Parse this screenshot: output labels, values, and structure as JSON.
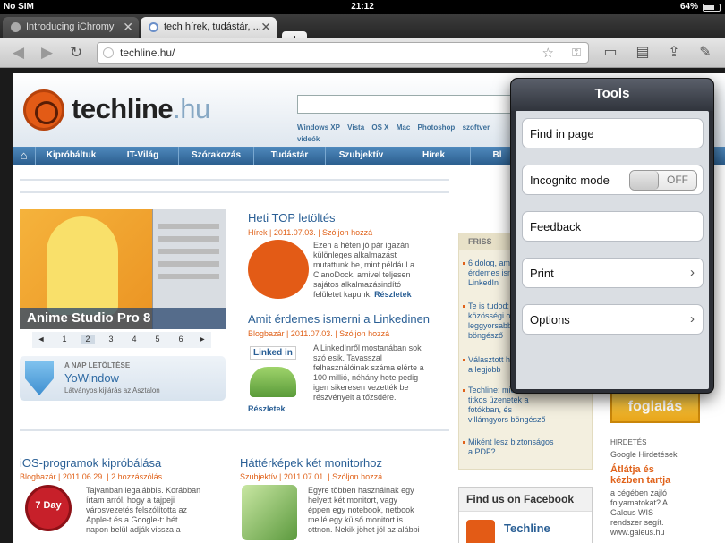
{
  "status": {
    "carrier": "No SIM",
    "time": "21:12",
    "battery": "64%"
  },
  "tabs": [
    {
      "label": "Introducing iChromy"
    },
    {
      "label": "tech hírek, tudástár, ..."
    }
  ],
  "new_tab_label": "+",
  "url": "techline.hu/",
  "site": {
    "logo_main": "techline",
    "logo_tld": ".hu",
    "quicklinks": [
      "Windows XP",
      "Vista",
      "OS X",
      "Mac",
      "Photoshop",
      "szoftver",
      "videók"
    ],
    "menu": [
      "Kipróbáltuk",
      "IT-Világ",
      "Szórakozás",
      "Tudástár",
      "Szubjektív",
      "Hírek",
      "Bl"
    ],
    "hero_caption": "Anime Studio Pro 8",
    "pager": [
      "◄",
      "1",
      "2",
      "3",
      "4",
      "5",
      "6",
      "►"
    ],
    "download": {
      "label": "A NAP LETÖLTÉSE",
      "title": "YoWindow",
      "sub": "Látványos kijlárás az Asztalon"
    },
    "articles": [
      {
        "title": "Heti TOP letöltés",
        "meta": "Hírek | 2011.07.03. | Szóljon hozzá",
        "body": [
          "Ezen a héten jó pár igazán",
          "különleges alkalmazást",
          "mutattunk be, mint például a",
          "ClanoDock, amivel teljesen",
          "sajátos alkalmazásindító",
          "felületet kapunk."
        ],
        "more": "Részletek"
      },
      {
        "title": "Amit érdemes ismerni a Linkedinen",
        "meta": "Blogbazár | 2011.07.03. | Szóljon hozzá",
        "body": [
          "A LinkedInről mostanában sok",
          "szó esik. Tavasszal",
          "felhasználóinak száma elérte a",
          "100 millió, néhány hete pedig",
          "igen sikeresen vezették be",
          "részvényeit a tőzsdére."
        ],
        "more": "Részletek",
        "thumb_label": "Linked in"
      },
      {
        "title": "iOS-programok kipróbálása",
        "meta": "Blogbazár | 2011.06.29. | 2 hozzászólás",
        "body": [
          "Tajvanban legalábbis. Korábban",
          "írtam arról, hogy a tajpeji",
          "városvezetés felszólította az",
          "Apple-t és a Google-t: hét",
          "napon belül adják vissza a"
        ],
        "badge": "7 Day"
      },
      {
        "title": "Háttérképek két monitorhoz",
        "meta": "Szubjektív | 2011.07.01. | Szóljon hozzá",
        "body": [
          "Egyre többen használnak egy",
          "helyett két monitort, vagy",
          "éppen egy notebook, netbook",
          "mellé egy külső monitort is",
          "ottnon. Nekik jöhet jól az alábbi"
        ]
      }
    ],
    "friss": {
      "head": "FRISS",
      "items": [
        [
          "6 dolog, amit",
          "érdemes ismerni a",
          "LinkedIn"
        ],
        [
          "Te is tudod: a",
          "közösségi oldalak",
          "leggyorsabb",
          "böngésző"
        ],
        [
          "Választott hogy",
          "a legjobb"
        ],
        [
          "Techline: miért",
          "titkos üzenetek a",
          "fotókban, és",
          "villámgyors böngésző"
        ],
        [
          "Miként lesz biztonságos",
          "a PDF?"
        ]
      ]
    },
    "facebook": {
      "head": "Find us on Facebook",
      "name": "Techline"
    },
    "ad": {
      "button": "foglalás",
      "small": "HIRDETÉS",
      "google": "Google Hirdetések",
      "link": [
        "Átlátja és",
        "kézben tartja"
      ],
      "text": [
        "a cégében zajló",
        "folyamatokat? A",
        "Galeus WIS",
        "rendszer segít.",
        "www.galeus.hu"
      ]
    }
  },
  "tools": {
    "title": "Tools",
    "find": "Find in page",
    "incognito": "Incognito mode",
    "incognito_state": "OFF",
    "feedback": "Feedback",
    "print": "Print",
    "options": "Options"
  }
}
